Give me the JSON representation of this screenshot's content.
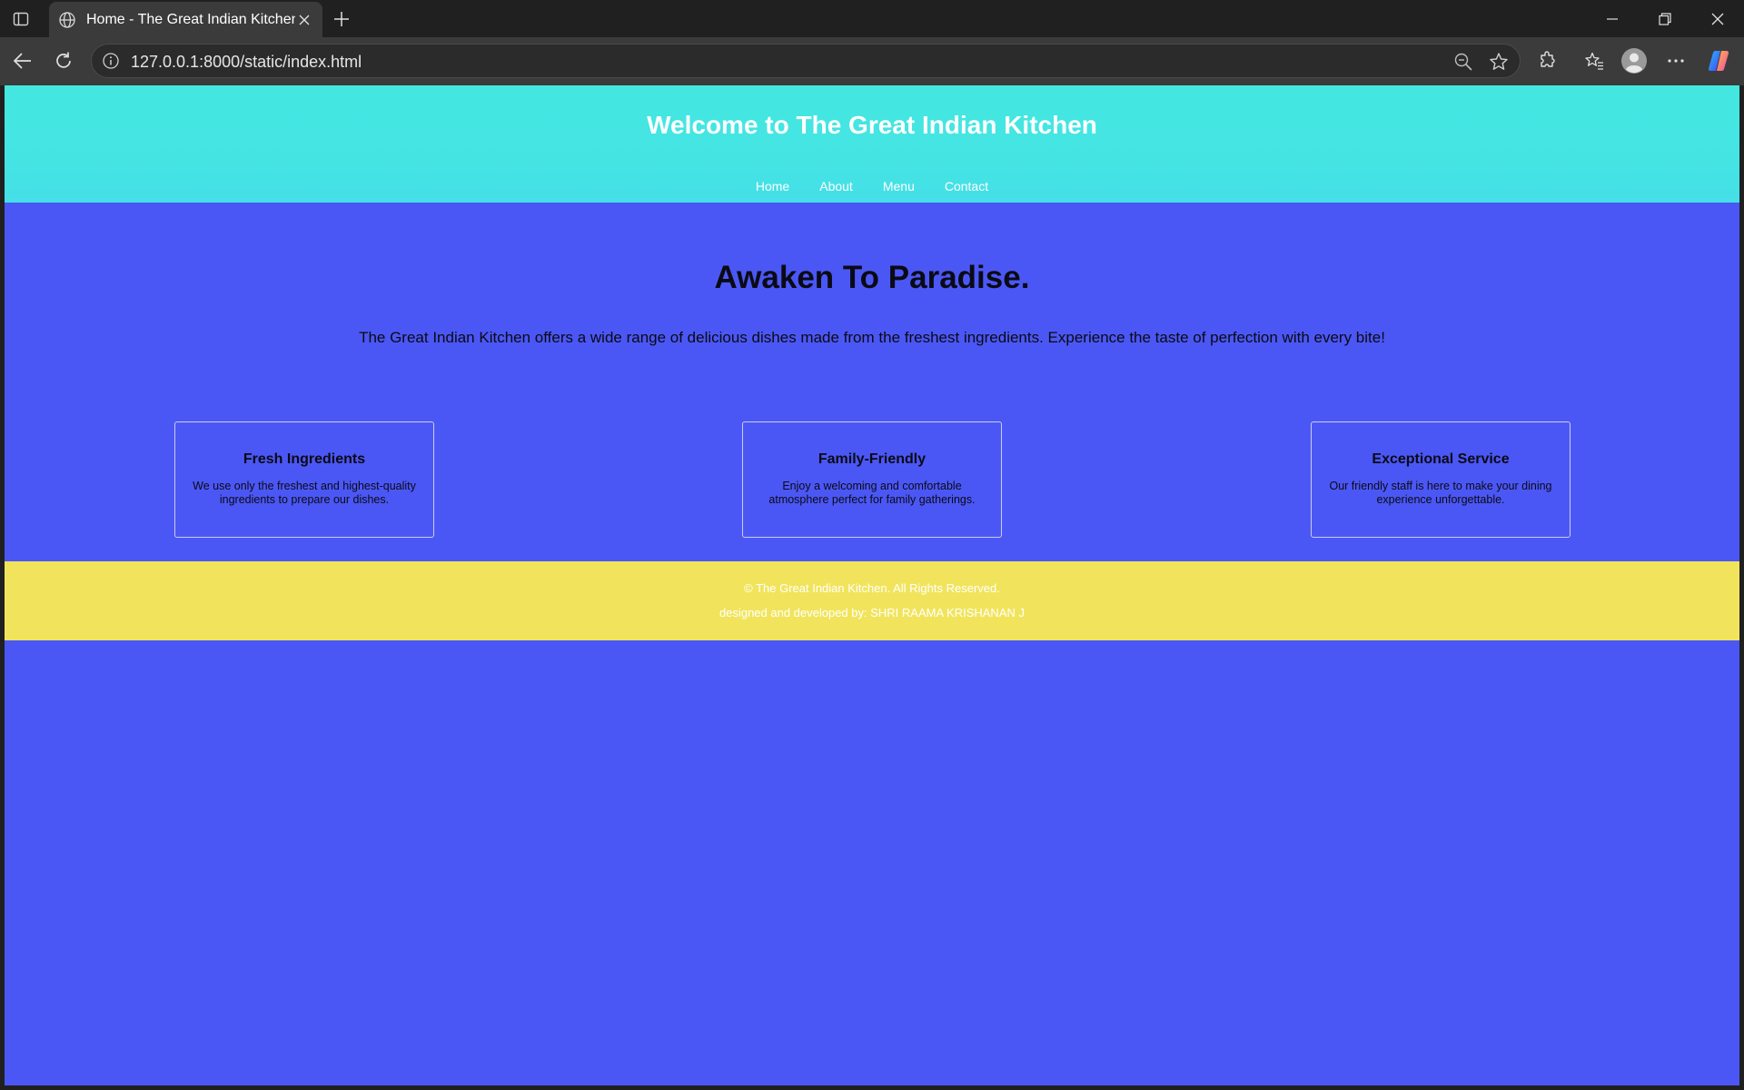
{
  "browser": {
    "tab_title": "Home - The Great Indian Kitchen",
    "url": "127.0.0.1:8000/static/index.html"
  },
  "site": {
    "title": "Welcome to The Great Indian Kitchen",
    "nav": [
      "Home",
      "About",
      "Menu",
      "Contact"
    ],
    "hero": {
      "heading": "Awaken To Paradise.",
      "text": "The Great Indian Kitchen offers a wide range of delicious dishes made from the freshest ingredients. Experience the taste of perfection with every bite!"
    },
    "features": [
      {
        "title": "Fresh Ingredients",
        "text": "We use only the freshest and highest-quality ingredients to prepare our dishes."
      },
      {
        "title": "Family-Friendly",
        "text": "Enjoy a welcoming and comfortable atmosphere perfect for family gatherings."
      },
      {
        "title": "Exceptional Service",
        "text": "Our friendly staff is here to make your dining experience unforgettable."
      }
    ],
    "footer": {
      "copyright": "© The Great Indian Kitchen. All Rights Reserved.",
      "credit": "designed and developed by: SHRI RAAMA KRISHANAN J"
    }
  },
  "colors": {
    "header": "#43e7e0",
    "body": "#4b57f4",
    "footer": "#f1e45c"
  }
}
